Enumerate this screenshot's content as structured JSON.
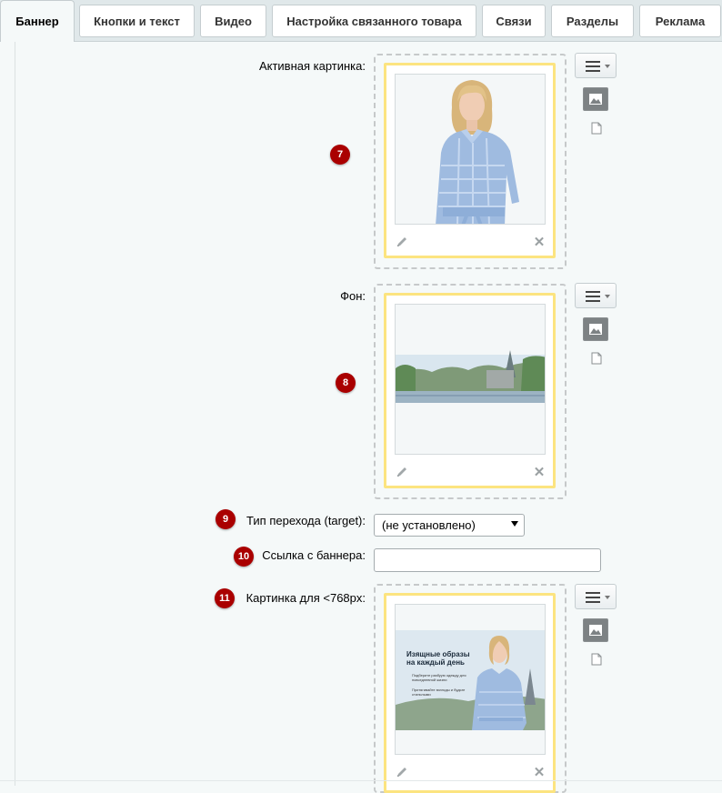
{
  "tabs": [
    {
      "label": "Баннер",
      "active": true
    },
    {
      "label": "Кнопки и текст",
      "active": false
    },
    {
      "label": "Видео",
      "active": false
    },
    {
      "label": "Настройка связанного товара",
      "active": false
    },
    {
      "label": "Связи",
      "active": false
    },
    {
      "label": "Разделы",
      "active": false
    },
    {
      "label": "Реклама",
      "active": false
    }
  ],
  "fields": {
    "active_image": {
      "label": "Активная картинка:",
      "badge": "7"
    },
    "background": {
      "label": "Фон:",
      "badge": "8"
    },
    "target": {
      "label": "Тип перехода (target):",
      "badge": "9",
      "value": "(не установлено)"
    },
    "link": {
      "label": "Ссылка с баннера:",
      "badge": "10",
      "value": ""
    },
    "mobile_image": {
      "label": "Картинка для <768px:",
      "badge": "11"
    }
  },
  "mobile_preview": {
    "heading": "Изящные образы на каждый день",
    "bullet1": "Подберите разбуую одежду для повседневной жизни",
    "bullet2": "Притягивайте взгляды и будьте стильными"
  },
  "icons": {
    "menu": "hamburger-dropdown-icon",
    "image": "image-icon",
    "file": "file-icon",
    "edit": "pencil-icon",
    "delete": "close-icon"
  },
  "colors": {
    "badge": "#aa0000",
    "frame": "#fce480",
    "background": "#f5f9f9"
  }
}
